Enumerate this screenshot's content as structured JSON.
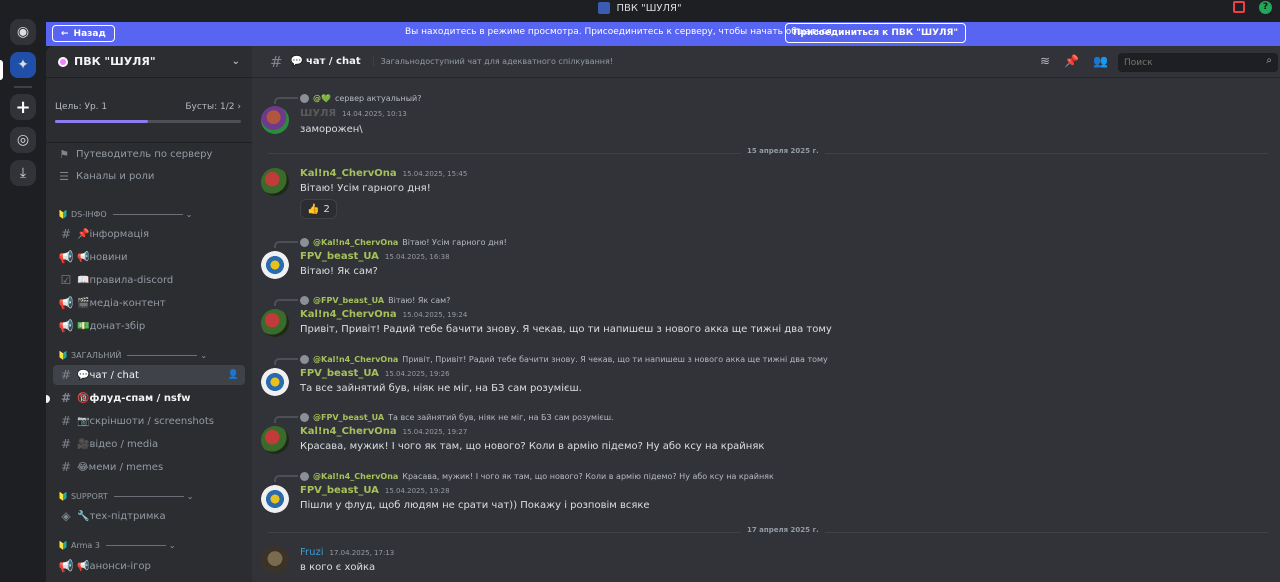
{
  "titlebar": {
    "title": "ПВК \"ШУЛЯ\""
  },
  "notice": {
    "back_label": "Назад",
    "text": "Вы находитесь в режиме просмотра. Присоединитесь к серверу, чтобы начать общаться.",
    "join_label": "Присоединиться к ПВК \"ШУЛЯ\""
  },
  "colors": {
    "accent": "#5865f2",
    "sidebar": "#2b2d31",
    "chat_bg": "#313338",
    "kalina_name": "#a6c15b",
    "fpv_name": "#a6c15b",
    "fruzi_name": "#3aa0d6",
    "shulya_name": "#5a5a5a"
  },
  "server": {
    "name": "ПВК \"ШУЛЯ\"",
    "goal_label": "Цель: Ур. 1",
    "boosts_label": "Бусты: 1/2",
    "boost_progress": 0.5
  },
  "nav": {
    "guide": "Путеводитель по серверу",
    "channels_roles": "Каналы и роли"
  },
  "categories": {
    "ds_info": "DS-ІНФО",
    "general": "ЗАГАЛЬНИЙ",
    "support": "SUPPORT",
    "arma": "Arma 3"
  },
  "channels": {
    "info": "📌інформація",
    "news": "📢новини",
    "rules": "📖правила-discord",
    "media_content": "🎬медіа-контент",
    "donate": "💵донат-збір",
    "chat": "💬чат / chat",
    "flood": "🔞флуд-спам / nsfw",
    "screenshots": "📷скріншоти / screenshots",
    "video": "🎥відео / media",
    "memes": "😂меми / memes",
    "tech": "🔧тех-підтримка",
    "arma_announce": "📢анонси-ігор"
  },
  "header": {
    "channel": "чат / chat",
    "topic": "Загальнодоступний чат для адекватного спілкування!",
    "search_placeholder": "Поиск"
  },
  "messages": [
    {
      "reply_name": "@💚",
      "reply_text": "сервер актуальный?",
      "author": "ШУЛЯ",
      "time": "14.04.2025, 10:13",
      "text": "заморожен\\"
    },
    {
      "divider": "15 апреля 2025 г."
    },
    {
      "author": "Kal!n4_ChervOna",
      "time": "15.04.2025, 15:45",
      "text": "Вітаю! Усім гарного дня!",
      "reaction_emoji": "👍",
      "reaction_count": "2"
    },
    {
      "reply_name": "@Kal!n4_ChervOna",
      "reply_text": "Вітаю! Усім гарного дня!",
      "author": "FPV_beast_UA",
      "time": "15.04.2025, 16:38",
      "text": "Вітаю! Як сам?"
    },
    {
      "reply_name": "@FPV_beast_UA",
      "reply_text": "Вітаю! Як сам?",
      "author": "Kal!n4_ChervOna",
      "time": "15.04.2025, 19:24",
      "text": "Привіт, Привіт! Радий тебе бачити знову. Я чекав, що ти напишеш з нового акка ще тижні два тому"
    },
    {
      "reply_name": "@Kal!n4_ChervOna",
      "reply_text": "Привіт, Привіт! Радий тебе бачити знову. Я чекав, що ти напишеш з нового акка ще тижні два тому",
      "author": "FPV_beast_UA",
      "time": "15.04.2025, 19:26",
      "text": "Та все зайнятий був, ніяк не міг, на БЗ сам розумієш."
    },
    {
      "reply_name": "@FPV_beast_UA",
      "reply_text": "Та все зайнятий був, ніяк не міг, на БЗ сам розумієш.",
      "author": "Kal!n4_ChervOna",
      "time": "15.04.2025, 19:27",
      "text": "Красава, мужик! І чого як там, що нового? Коли в армію підемо? Ну або ксу на крайняк"
    },
    {
      "reply_name": "@Kal!n4_ChervOna",
      "reply_text": "Красава, мужик! І чого як там, що нового? Коли в армію підемо? Ну або ксу на крайняк",
      "author": "FPV_beast_UA",
      "time": "15.04.2025, 19:28",
      "text": "Пішли у флуд, щоб людям не срати чат)) Покажу і розповім всяке"
    },
    {
      "divider": "17 апреля 2025 г."
    },
    {
      "author": "Fruzi",
      "time": "17.04.2025, 17:13",
      "text": "в кого є хойка"
    }
  ]
}
